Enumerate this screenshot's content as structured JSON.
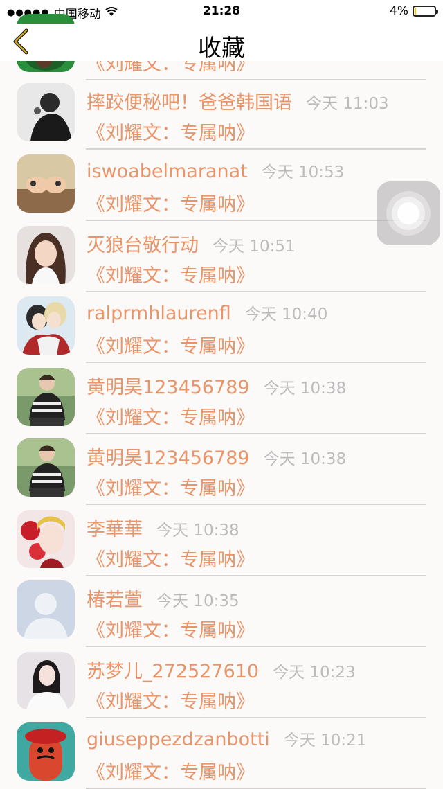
{
  "status_bar": {
    "signal_dots": "●●●●●",
    "carrier": "中国移动",
    "wifi_icon": "wifi-icon",
    "time": "21:28",
    "battery_text": "4%",
    "battery_level": 0.04
  },
  "nav": {
    "title": "收藏",
    "back_icon": "chevron-left-icon"
  },
  "rows": [
    {
      "name": "",
      "time": "",
      "message": "《刘耀文：专属呐》"
    },
    {
      "name": "摔跤便秘吧！爸爸韩国语",
      "time": "今天 11:03",
      "message": "《刘耀文：专属呐》"
    },
    {
      "name": "iswoabelmaranat",
      "time": "今天 10:53",
      "message": "《刘耀文：专属呐》"
    },
    {
      "name": "灭狼台敬行动",
      "time": "今天 10:51",
      "message": "《刘耀文：专属呐》"
    },
    {
      "name": "ralprmhlaurenfl",
      "time": "今天 10:40",
      "message": "《刘耀文：专属呐》"
    },
    {
      "name": "黄明昊123456789",
      "time": "今天 10:38",
      "message": "《刘耀文：专属呐》"
    },
    {
      "name": "黄明昊123456789",
      "time": "今天 10:38",
      "message": "《刘耀文：专属呐》"
    },
    {
      "name": "李華華",
      "time": "今天 10:38",
      "message": "《刘耀文：专属呐》"
    },
    {
      "name": "椿若萱",
      "time": "今天 10:35",
      "message": "《刘耀文：专属呐》"
    },
    {
      "name": "苏梦儿_272527610",
      "time": "今天 10:23",
      "message": "《刘耀文：专属呐》"
    },
    {
      "name": "giuseppezdzanbotti",
      "time": "今天 10:21",
      "message": "《刘耀文：专属呐》"
    }
  ],
  "colors": {
    "accent": "#e8956a",
    "time_gray": "#bcbcbc",
    "back_chevron": "#c9a227"
  }
}
